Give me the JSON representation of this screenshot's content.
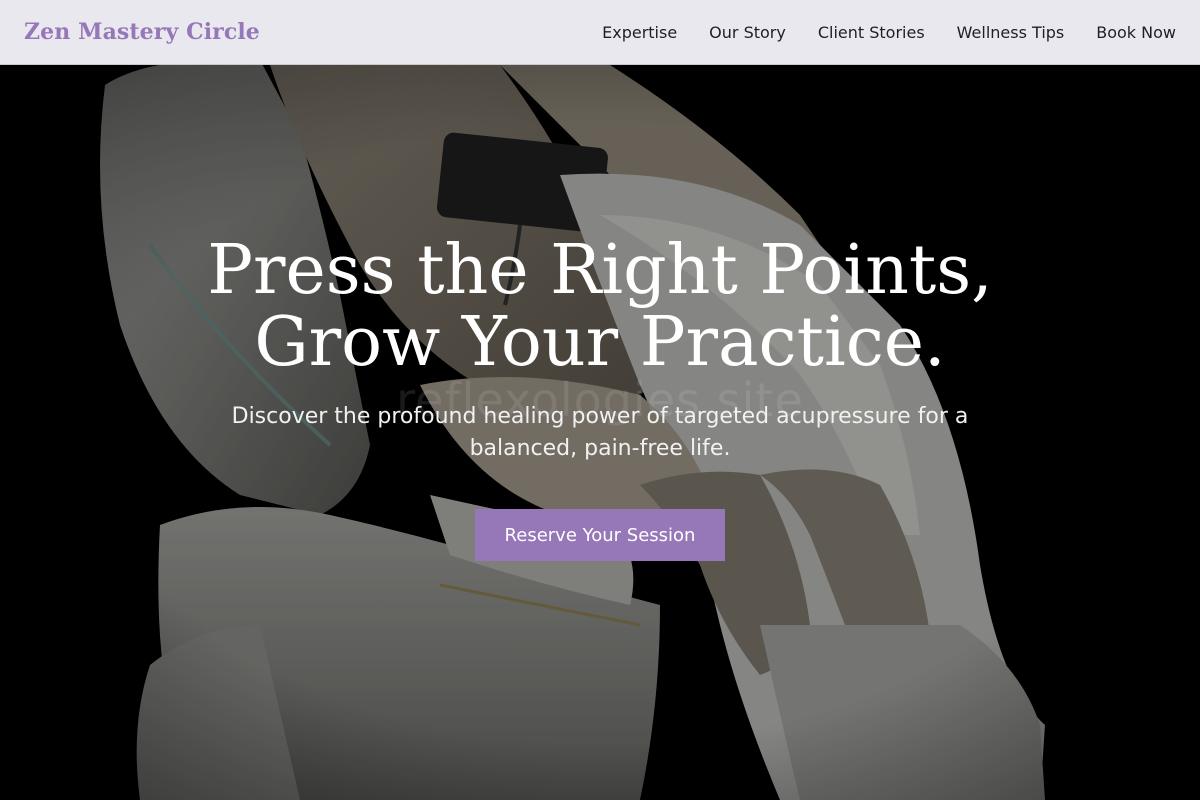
{
  "brand": {
    "name": "Zen Mastery Circle",
    "color": "#9678b8"
  },
  "nav": {
    "items": [
      {
        "label": "Expertise"
      },
      {
        "label": "Our Story"
      },
      {
        "label": "Client Stories"
      },
      {
        "label": "Wellness Tips"
      },
      {
        "label": "Book Now"
      }
    ]
  },
  "hero": {
    "title_line1": "Press the Right Points,",
    "title_line2": "Grow Your Practice.",
    "subtitle": "Discover the profound healing power of targeted acupressure for a balanced, pain-free life.",
    "cta_label": "Reserve Your Session",
    "watermark": "reflexologies.site",
    "image_subject": "massage-chair-image"
  },
  "colors": {
    "accent": "#9678b8",
    "navbar_bg": "#e9e8ee",
    "hero_bg": "#000000",
    "text_light": "#ffffff"
  }
}
